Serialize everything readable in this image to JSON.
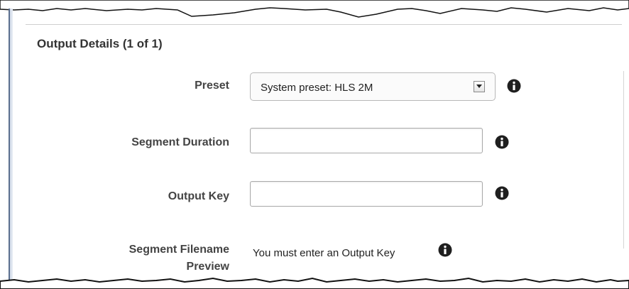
{
  "section": {
    "title": "Output Details (1 of 1)"
  },
  "fields": {
    "preset": {
      "label": "Preset",
      "value": "System preset: HLS 2M"
    },
    "segment_duration": {
      "label": "Segment Duration",
      "value": ""
    },
    "output_key": {
      "label": "Output Key",
      "value": ""
    },
    "segment_filename_preview": {
      "label_line1": "Segment Filename",
      "label_line2": "Preview",
      "value": "You must enter an Output Key"
    }
  },
  "icons": {
    "info": "info-icon",
    "dropdown": "chevron-down-icon"
  },
  "colors": {
    "label_text": "#444444",
    "title_text": "#333333",
    "info_icon": "#1f1f1f"
  }
}
